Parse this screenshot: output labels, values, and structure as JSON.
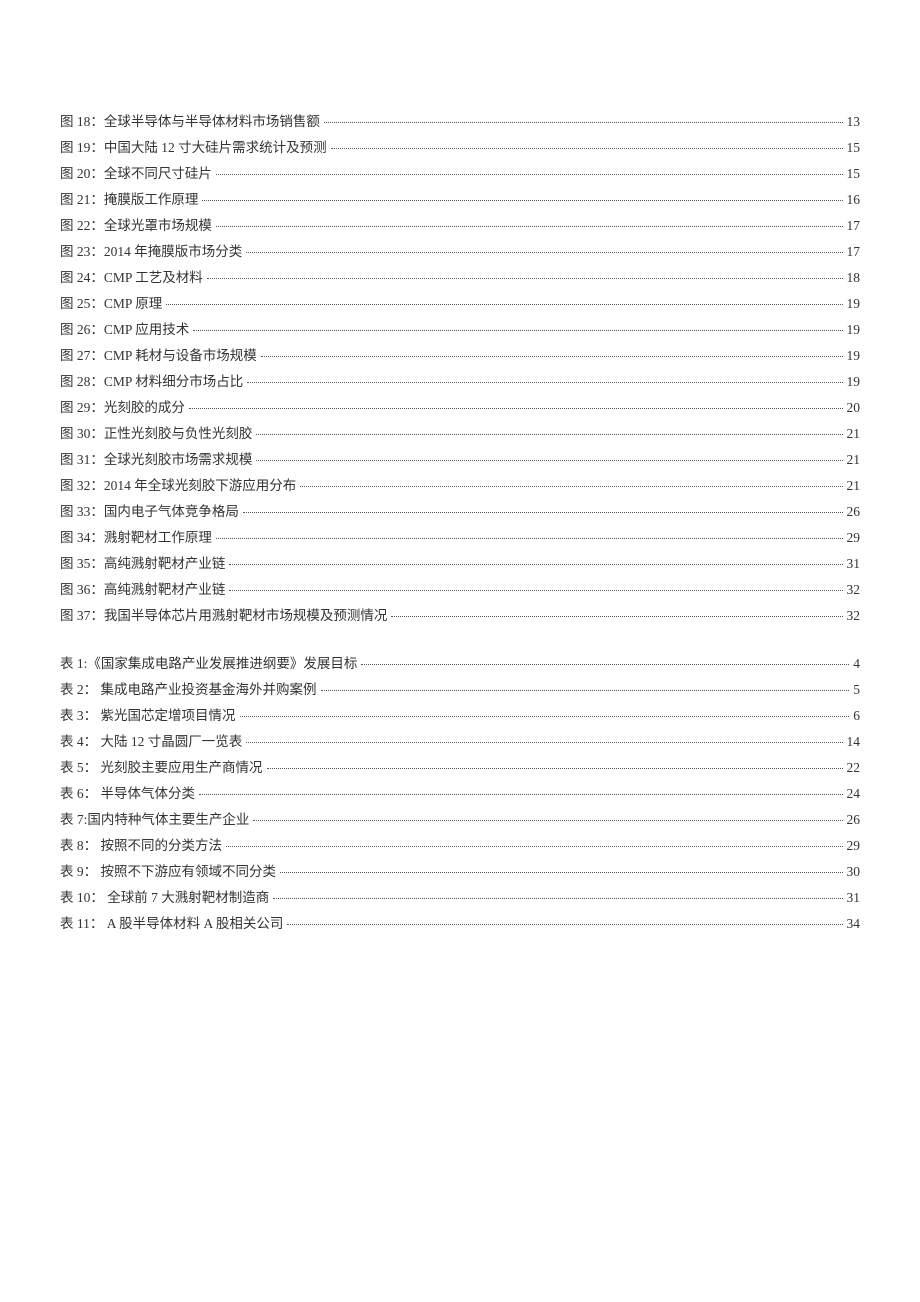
{
  "figures": [
    {
      "label": "图 18：全球半导体与半导体材料市场销售额",
      "page": "13"
    },
    {
      "label": "图 19：中国大陆 12 寸大硅片需求统计及预测",
      "page": "15"
    },
    {
      "label": "图 20：全球不同尺寸硅片",
      "page": "15"
    },
    {
      "label": "图 21：掩膜版工作原理",
      "page": "16"
    },
    {
      "label": "图 22：全球光罩市场规模",
      "page": "17"
    },
    {
      "label": "图 23：2014 年掩膜版市场分类",
      "page": "17"
    },
    {
      "label": "图 24：CMP 工艺及材料",
      "page": "18"
    },
    {
      "label": "图 25：CMP 原理",
      "page": "19"
    },
    {
      "label": "图 26：CMP 应用技术",
      "page": "19"
    },
    {
      "label": "图 27：CMP 耗材与设备市场规模",
      "page": "19"
    },
    {
      "label": "图 28：CMP 材料细分市场占比",
      "page": "19"
    },
    {
      "label": "图 29：光刻胶的成分",
      "page": "20"
    },
    {
      "label": "图 30：正性光刻胶与负性光刻胶",
      "page": "21"
    },
    {
      "label": "图 31：全球光刻胶市场需求规模",
      "page": "21"
    },
    {
      "label": "图 32：2014 年全球光刻胶下游应用分布",
      "page": "21"
    },
    {
      "label": "图 33：国内电子气体竞争格局",
      "page": "26"
    },
    {
      "label": "图 34：溅射靶材工作原理",
      "page": "29"
    },
    {
      "label": "图 35：高纯溅射靶材产业链",
      "page": "31"
    },
    {
      "label": "图 36：高纯溅射靶材产业链",
      "page": "32"
    },
    {
      "label": "图 37：我国半导体芯片用溅射靶材市场规模及预测情况",
      "page": "32"
    }
  ],
  "tables": [
    {
      "label": "表 1:《国家集成电路产业发展推进纲要》发展目标",
      "page": "4"
    },
    {
      "label": "表 2： 集成电路产业投资基金海外并购案例",
      "page": "5"
    },
    {
      "label": "表 3： 紫光国芯定增项目情况",
      "page": "6"
    },
    {
      "label": "表 4： 大陆 12 寸晶圆厂一览表",
      "page": "14"
    },
    {
      "label": "表 5： 光刻胶主要应用生产商情况",
      "page": "22"
    },
    {
      "label": "表 6： 半导体气体分类",
      "page": "24"
    },
    {
      "label": "表 7:国内特种气体主要生产企业",
      "page": "26"
    },
    {
      "label": "表 8： 按照不同的分类方法",
      "page": "29"
    },
    {
      "label": "表 9： 按照不下游应有领域不同分类",
      "page": "30"
    },
    {
      "label": "表 10： 全球前 7 大溅射靶材制造商",
      "page": "31"
    },
    {
      "label": "表 11： A 股半导体材料 A 股相关公司",
      "page": "34"
    }
  ]
}
